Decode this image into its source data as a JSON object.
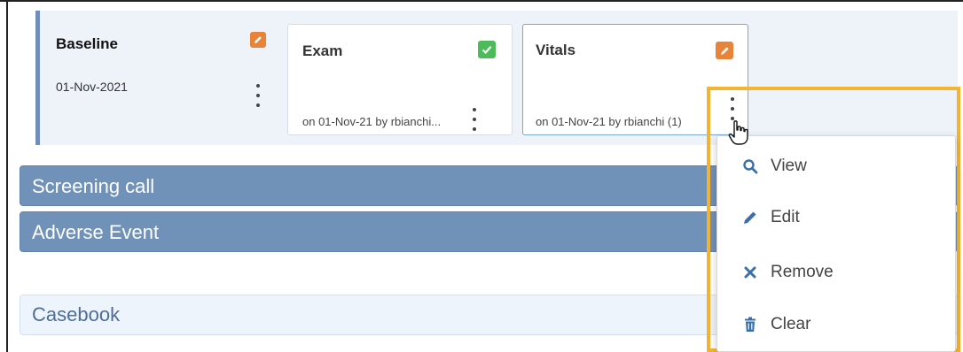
{
  "visit": {
    "title": "Baseline",
    "date": "01-Nov-2021",
    "status_icon": "edit-icon"
  },
  "forms": [
    {
      "title": "Exam",
      "status_icon": "check-icon",
      "meta": "on 01-Nov-21 by rbianchi..."
    },
    {
      "title": "Vitals",
      "status_icon": "edit-icon",
      "meta": "on 01-Nov-21 by rbianchi (1)"
    }
  ],
  "events": [
    {
      "label": "Screening call"
    },
    {
      "label": "Adverse Event"
    }
  ],
  "casebook": {
    "label": "Casebook"
  },
  "context_menu": {
    "items": [
      {
        "label": "View",
        "icon": "search-icon"
      },
      {
        "label": "Edit",
        "icon": "pencil-icon"
      },
      {
        "label": "Remove",
        "icon": "x-icon"
      },
      {
        "label": "Clear",
        "icon": "trash-icon"
      }
    ]
  },
  "colors": {
    "edit_orange": "#e8833a",
    "check_green": "#4cbb5a",
    "event_blue": "#7091b8",
    "highlight_yellow": "#f3b531",
    "menu_icon_blue": "#3a6fa8"
  }
}
